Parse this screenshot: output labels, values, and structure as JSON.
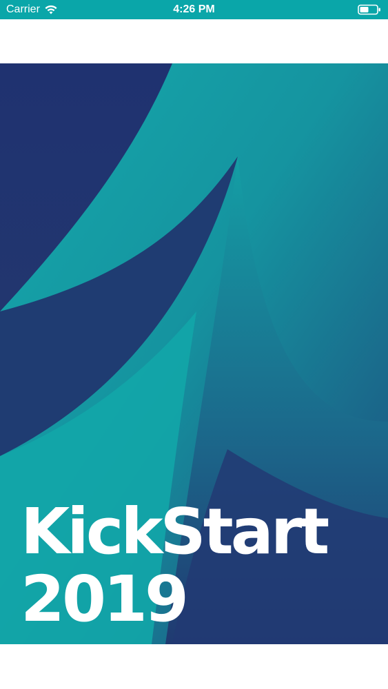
{
  "status_bar": {
    "carrier": "Carrier",
    "time": "4:26 PM",
    "wifi_icon": "wifi-icon",
    "battery_icon": "battery-icon",
    "background_color": "#0aa6a9"
  },
  "hero": {
    "title": "KickStart",
    "year": "2019",
    "colors": {
      "teal": "#12a5a8",
      "navy": "#1f3270",
      "deep_blue": "#23406f"
    }
  }
}
